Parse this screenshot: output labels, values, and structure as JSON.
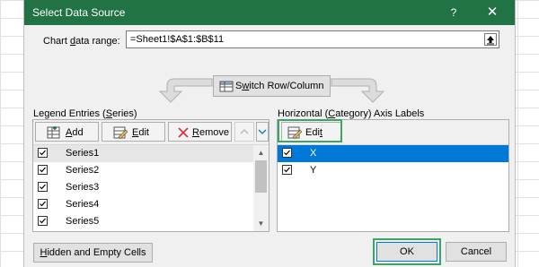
{
  "dialog": {
    "title": "Select Data Source",
    "help_label": "?",
    "close_label": "✕"
  },
  "data_range": {
    "label_pre": "Chart ",
    "label_underlined": "d",
    "label_post": "ata range:",
    "value": "=Sheet1!$A$1:$B$11"
  },
  "switch_button": {
    "label_underlined": "w",
    "label_pre": "S",
    "label_post": "itch Row/Column"
  },
  "legend": {
    "label_pre": "Legend Entries (",
    "label_underlined": "S",
    "label_post": "eries)",
    "add_pre": "",
    "add_underlined": "A",
    "add_post": "dd",
    "edit_pre": "",
    "edit_underlined": "E",
    "edit_post": "dit",
    "remove_pre": "",
    "remove_underlined": "R",
    "remove_post": "emove",
    "items": [
      {
        "label": "Series1",
        "checked": true
      },
      {
        "label": "Series2",
        "checked": true
      },
      {
        "label": "Series3",
        "checked": true
      },
      {
        "label": "Series4",
        "checked": true
      },
      {
        "label": "Series5",
        "checked": true
      }
    ]
  },
  "axis": {
    "label_pre": "Horizontal (",
    "label_underlined": "C",
    "label_post": "ategory) Axis Labels",
    "edit_pre": "Edi",
    "edit_underlined": "t",
    "edit_post": "",
    "items": [
      {
        "label": "X",
        "checked": true,
        "selected": true
      },
      {
        "label": "Y",
        "checked": true,
        "selected": false
      }
    ]
  },
  "footer": {
    "hidden_pre": "",
    "hidden_underlined": "H",
    "hidden_post": "idden and Empty Cells",
    "ok_label": "OK",
    "cancel_label": "Cancel"
  },
  "colors": {
    "titlebar": "#217346",
    "selection": "#0078d7",
    "highlight_frame": "#3aa566",
    "remove_icon": "#d13438"
  }
}
